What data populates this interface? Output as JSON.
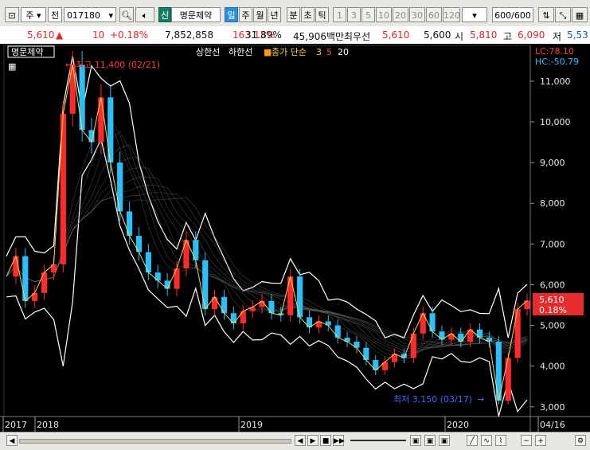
{
  "toolbar": {
    "market": "주",
    "category": "전",
    "code": "017180",
    "name_badge": "신",
    "name": "명문제약",
    "periods": [
      "일",
      "주",
      "월",
      "년",
      "분",
      "초",
      "틱"
    ],
    "active_period": "일",
    "minute_steps": [
      "1",
      "3",
      "5",
      "10",
      "20",
      "30",
      "60",
      "120"
    ],
    "count": "600",
    "count_total": "/600"
  },
  "quote": {
    "price": "5,610",
    "change": "10",
    "change_pct": "+0.18%",
    "volume": "7,852,858",
    "volume_ratio": "163.13%",
    "turnover": "31.89%",
    "amount": "45,906백만",
    "best_ask_label": "최우선",
    "best_ask": "5,610",
    "prev_close": "5,600",
    "open_label": "시",
    "open": "5,810",
    "high_label": "고",
    "high": "6,090",
    "low_label": "저",
    "low": "5,53"
  },
  "chart": {
    "legend_name": "명문제약",
    "legend_upper": "상한선",
    "legend_lower": "하한선",
    "legend_ma_label": "종가 단순",
    "ma_periods": [
      "3",
      "5",
      "20"
    ],
    "lc": "LC:78.10",
    "hc": "HC:-50.79",
    "max_note": "최고 11,400 (02/21)",
    "min_note": "최저 3,150 (03/17)",
    "price_label": "5,610",
    "price_pct": "0.18%",
    "y_ticks": [
      "11,000",
      "10,000",
      "9,000",
      "8,000",
      "7,000",
      "6,000",
      "5,000",
      "4,000",
      "3,000"
    ],
    "x_ticks": [
      "2017",
      "2018",
      "2019",
      "2020",
      "04/16"
    ]
  },
  "chart_data": {
    "type": "line",
    "title": "",
    "ylim": [
      2800,
      11800
    ],
    "series": [
      {
        "name": "명문제약",
        "values": [
          6200,
          6700,
          5600,
          5800,
          6300,
          6500,
          10200,
          11400,
          9800,
          9500,
          10600,
          9000,
          7800,
          7200,
          6800,
          6300,
          6100,
          5900,
          6400,
          7100,
          6600,
          5400,
          5700,
          5300,
          5050,
          5350,
          5450,
          5600,
          5300,
          5250,
          6200,
          5200,
          4950,
          5100,
          5000,
          4700,
          4600,
          4450,
          4150,
          3900,
          4100,
          4300,
          4200,
          4800,
          5300,
          4850,
          4650,
          4800,
          4600,
          4900,
          4700,
          4600,
          3150,
          4200,
          5400,
          5610
        ]
      }
    ]
  },
  "colors": {
    "up": "#ff2b2b",
    "down": "#28c0ff",
    "band": "#ffffff",
    "ma3": "#ffd54a"
  },
  "bottom": {
    "icons": [
      "prev-icon",
      "next-icon",
      "stop-icon",
      "fast-forward-icon",
      "zoom-out-icon",
      "zoom-in-icon",
      "settings-icon"
    ]
  }
}
